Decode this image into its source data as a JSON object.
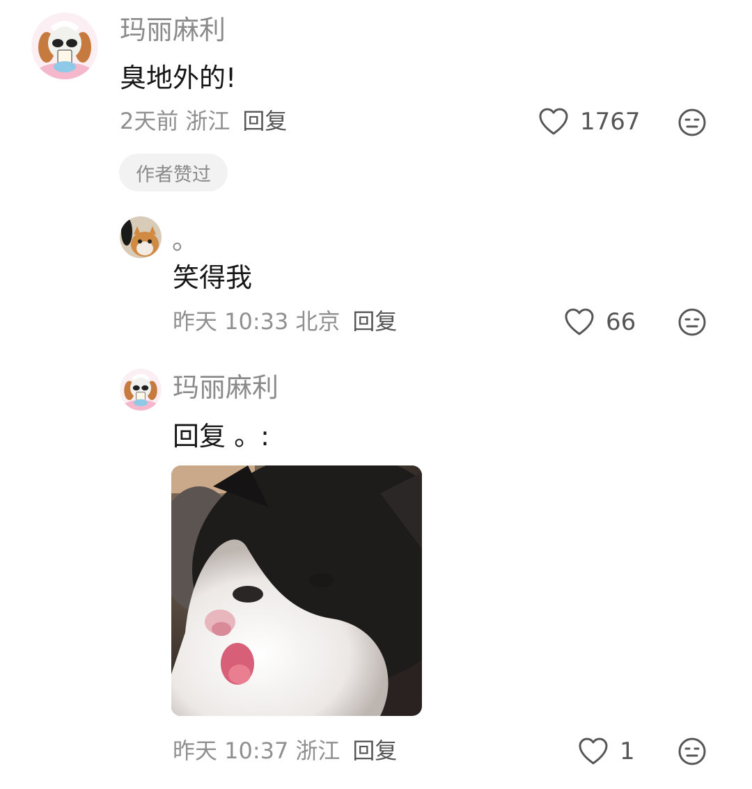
{
  "comments": [
    {
      "user": "玛丽麻利",
      "text": "臭地外的!",
      "time": "2天前",
      "location": "浙江",
      "reply_label": "回复",
      "likes": "1767",
      "tag": "作者赞过"
    },
    {
      "user": "。",
      "text": "笑得我",
      "time": "昨天 10:33",
      "location": "北京",
      "reply_label": "回复",
      "likes": "66"
    },
    {
      "user": "玛丽麻利",
      "text": "回复 。:",
      "time": "昨天 10:37",
      "location": "浙江",
      "reply_label": "回复",
      "likes": "1"
    }
  ],
  "icons": {
    "like": "heart-outline-icon",
    "dislike": "neutral-face-icon"
  },
  "colors": {
    "username": "#8a8a8a",
    "content": "#161616",
    "meta": "#8f8f8f",
    "icon": "#555555",
    "tag_bg": "#f2f2f2"
  }
}
